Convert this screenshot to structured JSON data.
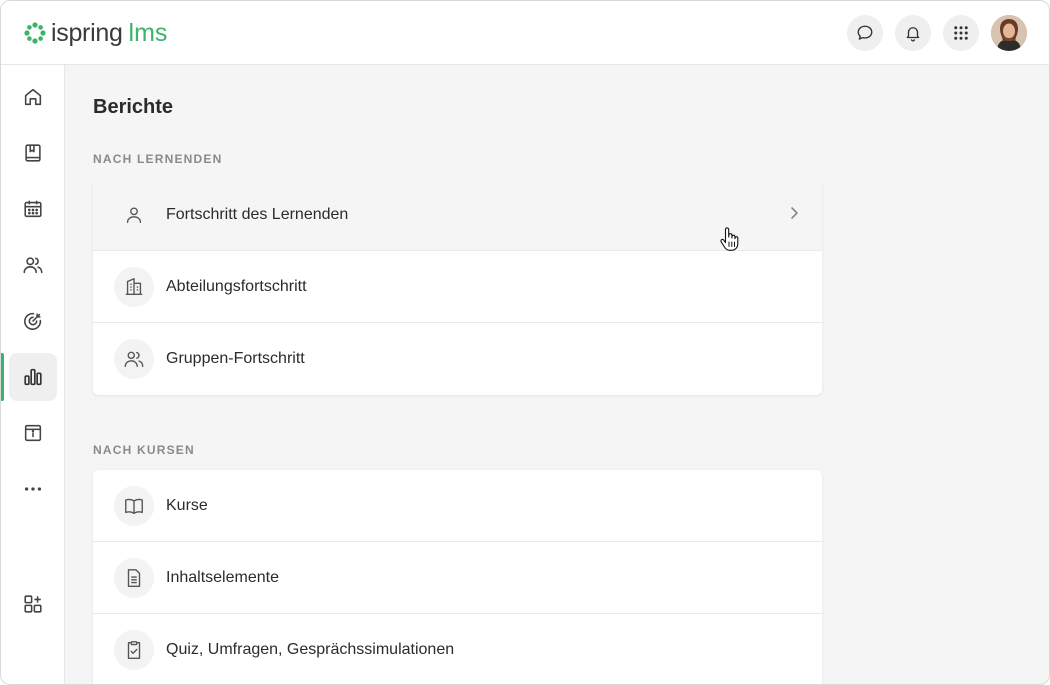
{
  "header": {
    "brand": "ispring",
    "brand_accent": "lms",
    "buttons": [
      {
        "name": "chat",
        "icon": "chat-bubble-icon"
      },
      {
        "name": "notifications",
        "icon": "bell-icon"
      },
      {
        "name": "apps",
        "icon": "grid-icon"
      }
    ]
  },
  "sidebar": {
    "items": [
      {
        "icon": "home-icon"
      },
      {
        "icon": "book-icon"
      },
      {
        "icon": "calendar-icon"
      },
      {
        "icon": "users-icon"
      },
      {
        "icon": "target-icon"
      },
      {
        "icon": "reports-chart-icon",
        "active": true
      },
      {
        "icon": "info-box-icon"
      },
      {
        "icon": "more-dots-icon"
      },
      {
        "icon": "add-apps-icon"
      }
    ]
  },
  "main": {
    "title": "Berichte",
    "sections": [
      {
        "label": "NACH LERNENDEN",
        "rows": [
          {
            "label": "Fortschritt des Lernenden",
            "icon": "user-icon"
          },
          {
            "label": "Abteilungsfortschritt",
            "icon": "building-icon"
          },
          {
            "label": "Gruppen-Fortschritt",
            "icon": "group-icon"
          }
        ]
      },
      {
        "label": "NACH KURSEN",
        "rows": [
          {
            "label": "Kurse",
            "icon": "open-book-icon"
          },
          {
            "label": "Inhaltselemente",
            "icon": "document-icon"
          },
          {
            "label": "Quiz, Umfragen, Gesprächssimulationen",
            "icon": "checklist-icon"
          }
        ]
      }
    ]
  },
  "colors": {
    "accent": "#3bb36a",
    "background": "#f5f5f5",
    "text": "#2b2b2b",
    "muted": "#8a8a8a"
  }
}
